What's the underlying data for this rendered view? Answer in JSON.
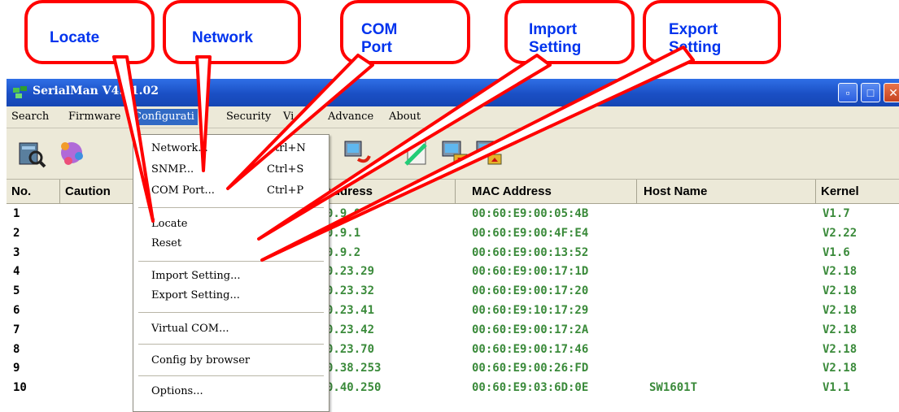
{
  "callouts": [
    {
      "text": "Locate"
    },
    {
      "text": "Network"
    },
    {
      "text": "COM\nPort"
    },
    {
      "text": "Import\nSetting"
    },
    {
      "text": "Export\nSetting"
    }
  ],
  "window": {
    "title": "SerialMan        V4.01.02",
    "icon": "serialmanager-app-icon"
  },
  "menubar": {
    "items": [
      "Search",
      "Firmware",
      "Configurati",
      "Security",
      "Vi",
      "Advance",
      "About"
    ]
  },
  "toolbar": {
    "icons": [
      "locate-server-icon",
      "network-globe-icon",
      "com-port-icon",
      "refresh-pc-icon",
      "edit-config-icon",
      "import-setting-icon",
      "export-setting-icon"
    ]
  },
  "dropdown": {
    "items": [
      {
        "label": "Network...",
        "shortcut": "Ctrl+N"
      },
      {
        "label": "SNMP...",
        "shortcut": "Ctrl+S"
      },
      {
        "label": "COM Port...",
        "shortcut": "Ctrl+P"
      },
      {
        "label": "Locate",
        "shortcut": ""
      },
      {
        "label": "Reset",
        "shortcut": ""
      },
      {
        "label": "Import Setting...",
        "shortcut": ""
      },
      {
        "label": "Export Setting...",
        "shortcut": ""
      },
      {
        "label": "Virtual COM...",
        "shortcut": ""
      },
      {
        "label": "Config by browser",
        "shortcut": ""
      },
      {
        "label": "Options...",
        "shortcut": ""
      }
    ]
  },
  "table": {
    "headers": [
      "No.",
      "Caution",
      "Address",
      "MAC Address",
      "Host Name",
      "Kernel"
    ],
    "rows": [
      {
        "no": "1",
        "ip": "0.9.0",
        "mac": "00:60:E9:00:05:4B",
        "host": "",
        "kernel": "V1.7"
      },
      {
        "no": "2",
        "ip": "0.9.1",
        "mac": "00:60:E9:00:4F:E4",
        "host": "",
        "kernel": "V2.22"
      },
      {
        "no": "3",
        "ip": "0.9.2",
        "mac": "00:60:E9:00:13:52",
        "host": "",
        "kernel": "V1.6"
      },
      {
        "no": "4",
        "ip": "0.23.29",
        "mac": "00:60:E9:00:17:1D",
        "host": "",
        "kernel": "V2.18"
      },
      {
        "no": "5",
        "ip": "0.23.32",
        "mac": "00:60:E9:00:17:20",
        "host": "",
        "kernel": "V2.18"
      },
      {
        "no": "6",
        "ip": "0.23.41",
        "mac": "00:60:E9:10:17:29",
        "host": "",
        "kernel": "V2.18"
      },
      {
        "no": "7",
        "ip": "0.23.42",
        "mac": "00:60:E9:00:17:2A",
        "host": "",
        "kernel": "V2.18"
      },
      {
        "no": "8",
        "ip": "0.23.70",
        "mac": "00:60:E9:00:17:46",
        "host": "",
        "kernel": "V2.18"
      },
      {
        "no": "9",
        "ip": "0.38.253",
        "mac": "00:60:E9:00:26:FD",
        "host": "",
        "kernel": "V2.18"
      },
      {
        "no": "10",
        "ip": "0.40.250",
        "mac": "00:60:E9:03:6D:0E",
        "host": "SW1601T",
        "kernel": "V1.1"
      }
    ]
  },
  "colors": {
    "callout_border": "#ff0000",
    "callout_text": "#0033ee",
    "titlebar": "#1a4fc4",
    "menu_highlight": "#316ac5",
    "data_green": "#3a8a3a"
  }
}
